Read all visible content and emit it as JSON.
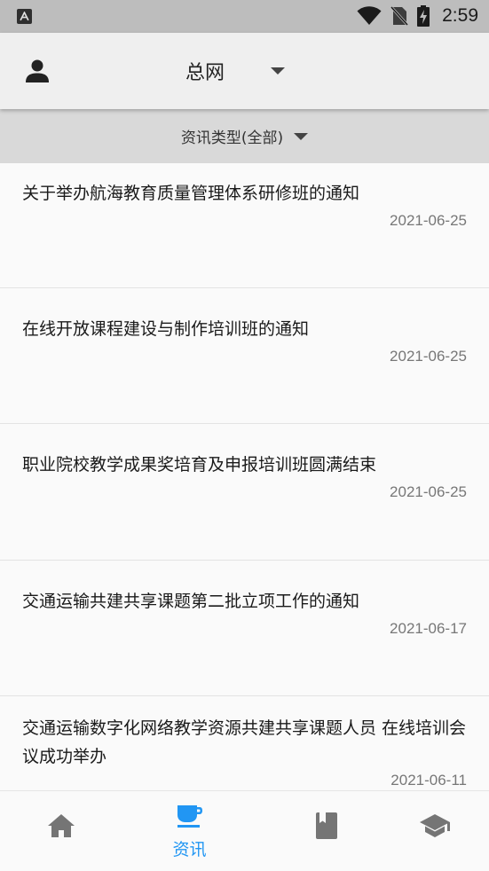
{
  "status_bar": {
    "time": "2:59",
    "icons": [
      "app-notification-icon",
      "wifi-icon",
      "no-sim-icon",
      "battery-charging-icon"
    ]
  },
  "app_bar": {
    "avatar_icon": "person-icon",
    "network_title": "总网",
    "dropdown_icon": "caret-down-icon"
  },
  "filter": {
    "label": "资讯类型(全部)",
    "dropdown_icon": "caret-down-icon"
  },
  "news": [
    {
      "title": "关于举办航海教育质量管理体系研修班的通知",
      "date": "2021-06-25"
    },
    {
      "title": "在线开放课程建设与制作培训班的通知",
      "date": "2021-06-25"
    },
    {
      "title": "职业院校教学成果奖培育及申报培训班圆满结束",
      "date": "2021-06-25"
    },
    {
      "title": "交通运输共建共享课题第二批立项工作的通知",
      "date": "2021-06-17"
    },
    {
      "title": "交通运输数字化网络教学资源共建共享课题人员 在线培训会议成功举办",
      "date": "2021-06-11"
    }
  ],
  "bottom_nav": {
    "items": [
      {
        "icon": "home-icon",
        "label": "",
        "active": false
      },
      {
        "icon": "coffee-cup-icon",
        "label": "资讯",
        "active": true
      },
      {
        "icon": "book-icon",
        "label": "",
        "active": false
      },
      {
        "icon": "graduation-cap-icon",
        "label": "",
        "active": false
      }
    ]
  },
  "colors": {
    "accent": "#2196f3",
    "inactive_icon": "#757575",
    "status_bar_bg": "#bdbdbd",
    "app_bar_bg": "#efefef",
    "filter_bar_bg": "#d9d9d9"
  }
}
